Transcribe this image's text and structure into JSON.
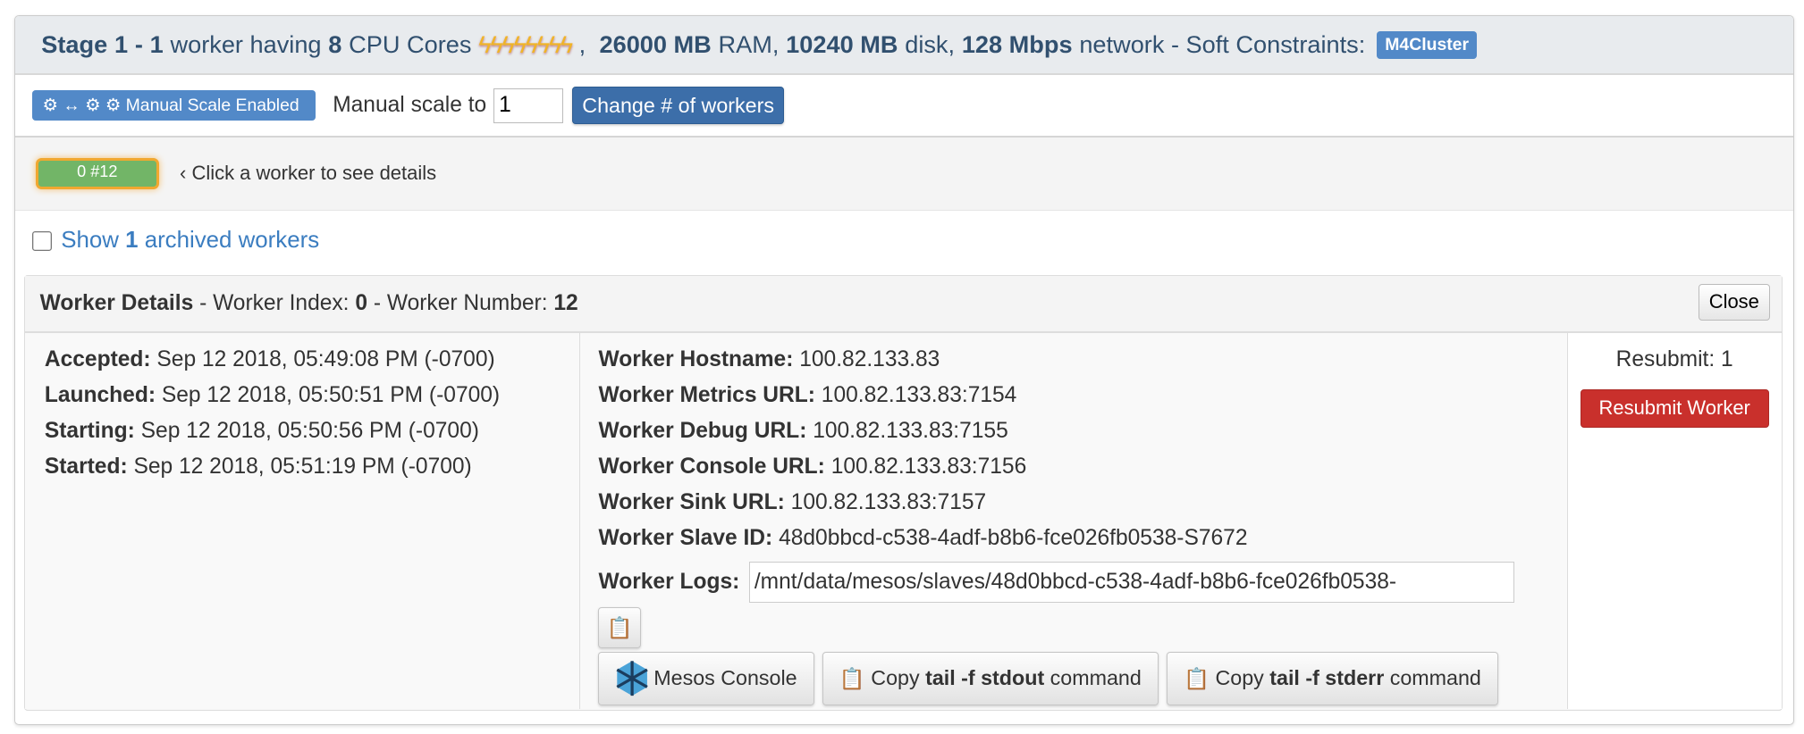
{
  "header": {
    "stage_label": "Stage",
    "stage_num": "1",
    "sep": "-",
    "workers": "1",
    "t1": "worker having",
    "cores": "8",
    "t2": "CPU Cores",
    "bolts": "ϟϟϟϟϟϟϟϟ",
    "ram": "26000 MB",
    "t3": "RAM,",
    "disk": "10240 MB",
    "t4": "disk,",
    "net": "128 Mbps",
    "t5": "network - Soft Constraints:",
    "constraint": "M4Cluster"
  },
  "toolbar": {
    "badge": "⚙ ↔ ⚙ ⚙ Manual Scale Enabled",
    "scale_label": "Manual scale to",
    "scale_value": "1",
    "change_button": "Change # of workers"
  },
  "workers": {
    "worker_button": "0 #12",
    "hint": "‹ Click a worker to see details"
  },
  "archived": {
    "show": "Show",
    "count": "1",
    "rest": "archived workers"
  },
  "details": {
    "title": "Worker Details",
    "index_label": "- Worker Index:",
    "index": "0",
    "number_label": "- Worker Number:",
    "number": "12",
    "close": "Close",
    "times": [
      {
        "label": "Accepted:",
        "value": "Sep 12 2018, 05:49:08 PM (-0700)"
      },
      {
        "label": "Launched:",
        "value": "Sep 12 2018, 05:50:51 PM (-0700)"
      },
      {
        "label": "Starting:",
        "value": "Sep 12 2018, 05:50:56 PM (-0700)"
      },
      {
        "label": "Started:",
        "value": "Sep 12 2018, 05:51:19 PM (-0700)"
      }
    ],
    "info": [
      {
        "label": "Worker Hostname:",
        "value": "100.82.133.83"
      },
      {
        "label": "Worker Metrics URL:",
        "value": "100.82.133.83:7154"
      },
      {
        "label": "Worker Debug URL:",
        "value": "100.82.133.83:7155"
      },
      {
        "label": "Worker Console URL:",
        "value": "100.82.133.83:7156"
      },
      {
        "label": "Worker Sink URL:",
        "value": "100.82.133.83:7157"
      },
      {
        "label": "Worker Slave ID:",
        "value": "48d0bbcd-c538-4adf-b8b6-fce026fb0538-S7672"
      }
    ],
    "logs_label": "Worker Logs:",
    "logs_value": "/mnt/data/mesos/slaves/48d0bbcd-c538-4adf-b8b6-fce026fb0538-",
    "mesos_console": "Mesos Console",
    "copy": "Copy",
    "stdout_cmd": "tail -f stdout",
    "stderr_cmd": "tail -f stderr",
    "command": "command",
    "resubmit_label": "Resubmit: 1",
    "resubmit_button": "Resubmit Worker"
  }
}
